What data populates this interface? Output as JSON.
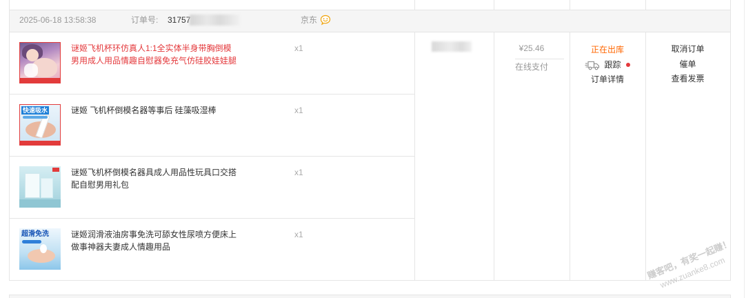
{
  "colors": {
    "text": "#333333",
    "muted": "#999999",
    "qty": "#aaaaaa",
    "border": "#e5e5e5",
    "header-bg": "#f5f5f5",
    "status": "#ff6600",
    "alert": "#e4393c",
    "chat": "#f0a30a",
    "icon-gray": "#888888"
  },
  "icons": {
    "shop_chat": "chat-icon",
    "tracking": "delivery-truck-icon"
  },
  "order": {
    "created_at": "2025-06-18 13:58:38",
    "order_number_label": "订单号:",
    "order_number_visible": "31757",
    "shop": "京东",
    "items": [
      {
        "title_lines": [
          "谜姬飞机杯环仿真人1:1全实体半身带胸倒模",
          "男用成人用品情趣自慰器免充气仿硅胶娃娃腿"
        ],
        "title_color": "#e4393c",
        "quantity": "x1"
      },
      {
        "title_lines": [
          "谜姬 飞机杯倒模名器等事后 硅藻吸湿棒"
        ],
        "title_color": "#333333",
        "quantity": "x1",
        "image_text": "快速吸水"
      },
      {
        "title_lines": [
          "谜姬飞机杯倒模名器具成人用品性玩具口交搭",
          "配自慰男用礼包"
        ],
        "title_color": "#333333",
        "quantity": "x1"
      },
      {
        "title_lines": [
          "谜姬润滑液油房事免洗可舔女性尿喷方便床上",
          "做事神器夫妻成人情趣用品"
        ],
        "title_color": "#333333",
        "quantity": "x1",
        "image_text": "超滑免洗"
      }
    ],
    "amount": "¥25.46",
    "payment_method": "在线支付",
    "status": "正在出库",
    "track_label": "跟踪",
    "detail_link": "订单详情",
    "actions": [
      "取消订单",
      "催单",
      "查看发票"
    ]
  },
  "watermark": {
    "line1": "赚客吧，有奖一起赚！",
    "line2": "www.zuanke8.com"
  }
}
